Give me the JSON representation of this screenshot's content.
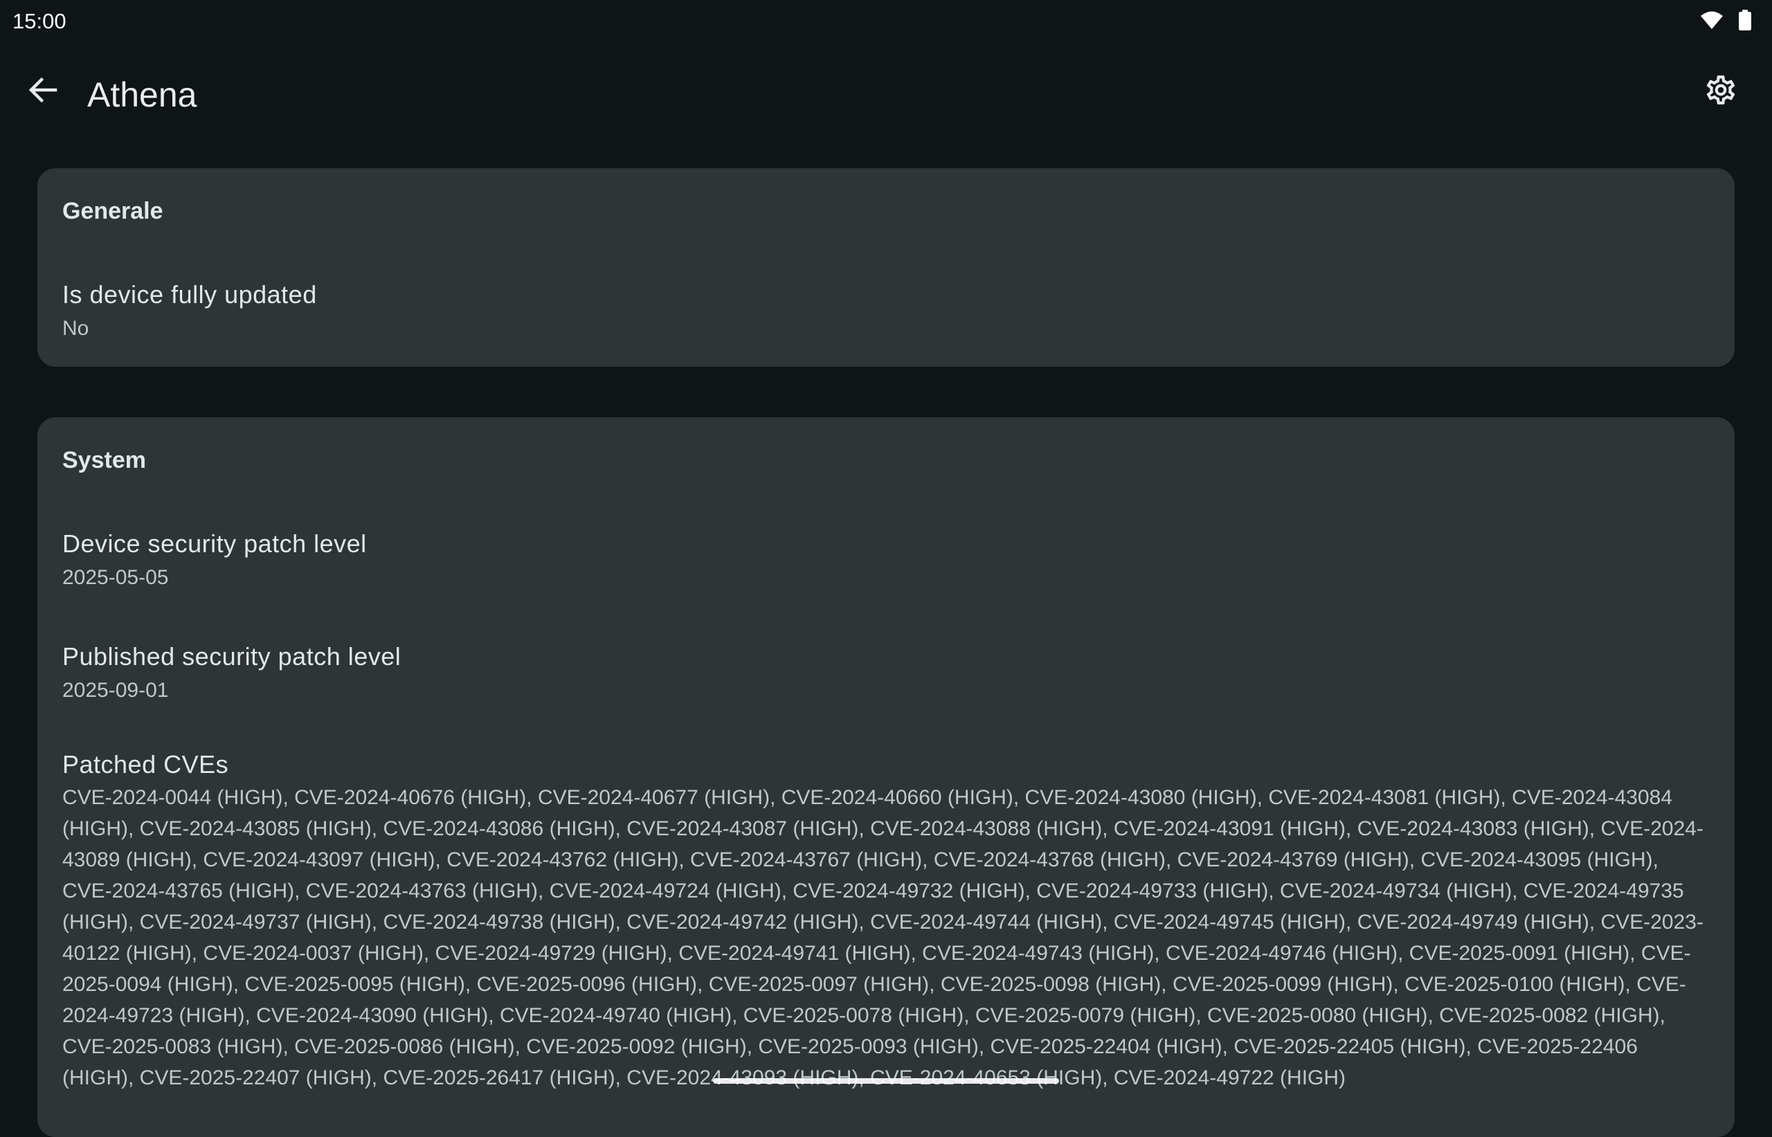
{
  "status_bar": {
    "time": "15:00",
    "icons": [
      "wifi-icon",
      "battery-icon"
    ]
  },
  "app_bar": {
    "title": "Athena",
    "back_icon": "arrow-back-icon",
    "settings_icon": "gear-icon"
  },
  "general": {
    "header": "Generale",
    "items": [
      {
        "title": "Is device fully updated",
        "summary": "No"
      }
    ]
  },
  "system": {
    "header": "System",
    "items": [
      {
        "title": "Device security patch level",
        "summary": "2025-05-05"
      },
      {
        "title": "Published security patch level",
        "summary": "2025-09-01"
      },
      {
        "title": "Patched CVEs",
        "summary": "CVE-2024-0044 (HIGH), CVE-2024-40676 (HIGH), CVE-2024-40677 (HIGH), CVE-2024-40660 (HIGH), CVE-2024-43080 (HIGH), CVE-2024-43081 (HIGH), CVE-2024-43084 (HIGH), CVE-2024-43085 (HIGH), CVE-2024-43086 (HIGH), CVE-2024-43087 (HIGH), CVE-2024-43088 (HIGH), CVE-2024-43091 (HIGH), CVE-2024-43083 (HIGH), CVE-2024-43089 (HIGH), CVE-2024-43097 (HIGH), CVE-2024-43762 (HIGH), CVE-2024-43767 (HIGH), CVE-2024-43768 (HIGH), CVE-2024-43769 (HIGH), CVE-2024-43095 (HIGH), CVE-2024-43765 (HIGH), CVE-2024-43763 (HIGH), CVE-2024-49724 (HIGH), CVE-2024-49732 (HIGH), CVE-2024-49733 (HIGH), CVE-2024-49734 (HIGH), CVE-2024-49735 (HIGH), CVE-2024-49737 (HIGH), CVE-2024-49738 (HIGH), CVE-2024-49742 (HIGH), CVE-2024-49744 (HIGH), CVE-2024-49745 (HIGH), CVE-2024-49749 (HIGH), CVE-2023-40122 (HIGH), CVE-2024-0037 (HIGH), CVE-2024-49729 (HIGH), CVE-2024-49741 (HIGH), CVE-2024-49743 (HIGH), CVE-2024-49746 (HIGH), CVE-2025-0091 (HIGH), CVE-2025-0094 (HIGH), CVE-2025-0095 (HIGH), CVE-2025-0096 (HIGH), CVE-2025-0097 (HIGH), CVE-2025-0098 (HIGH), CVE-2025-0099 (HIGH), CVE-2025-0100 (HIGH), CVE-2024-49723 (HIGH), CVE-2024-43090 (HIGH), CVE-2024-49740 (HIGH), CVE-2025-0078 (HIGH), CVE-2025-0079 (HIGH), CVE-2025-0080 (HIGH), CVE-2025-0082 (HIGH), CVE-2025-0083 (HIGH), CVE-2025-0086 (HIGH), CVE-2025-0092 (HIGH), CVE-2025-0093 (HIGH), CVE-2025-22404 (HIGH), CVE-2025-22405 (HIGH), CVE-2025-22406 (HIGH), CVE-2025-22407 (HIGH), CVE-2025-26417 (HIGH), CVE-2024-43093 (HIGH), CVE-2024-40653 (HIGH), CVE-2024-49722 (HIGH)"
      }
    ]
  }
}
